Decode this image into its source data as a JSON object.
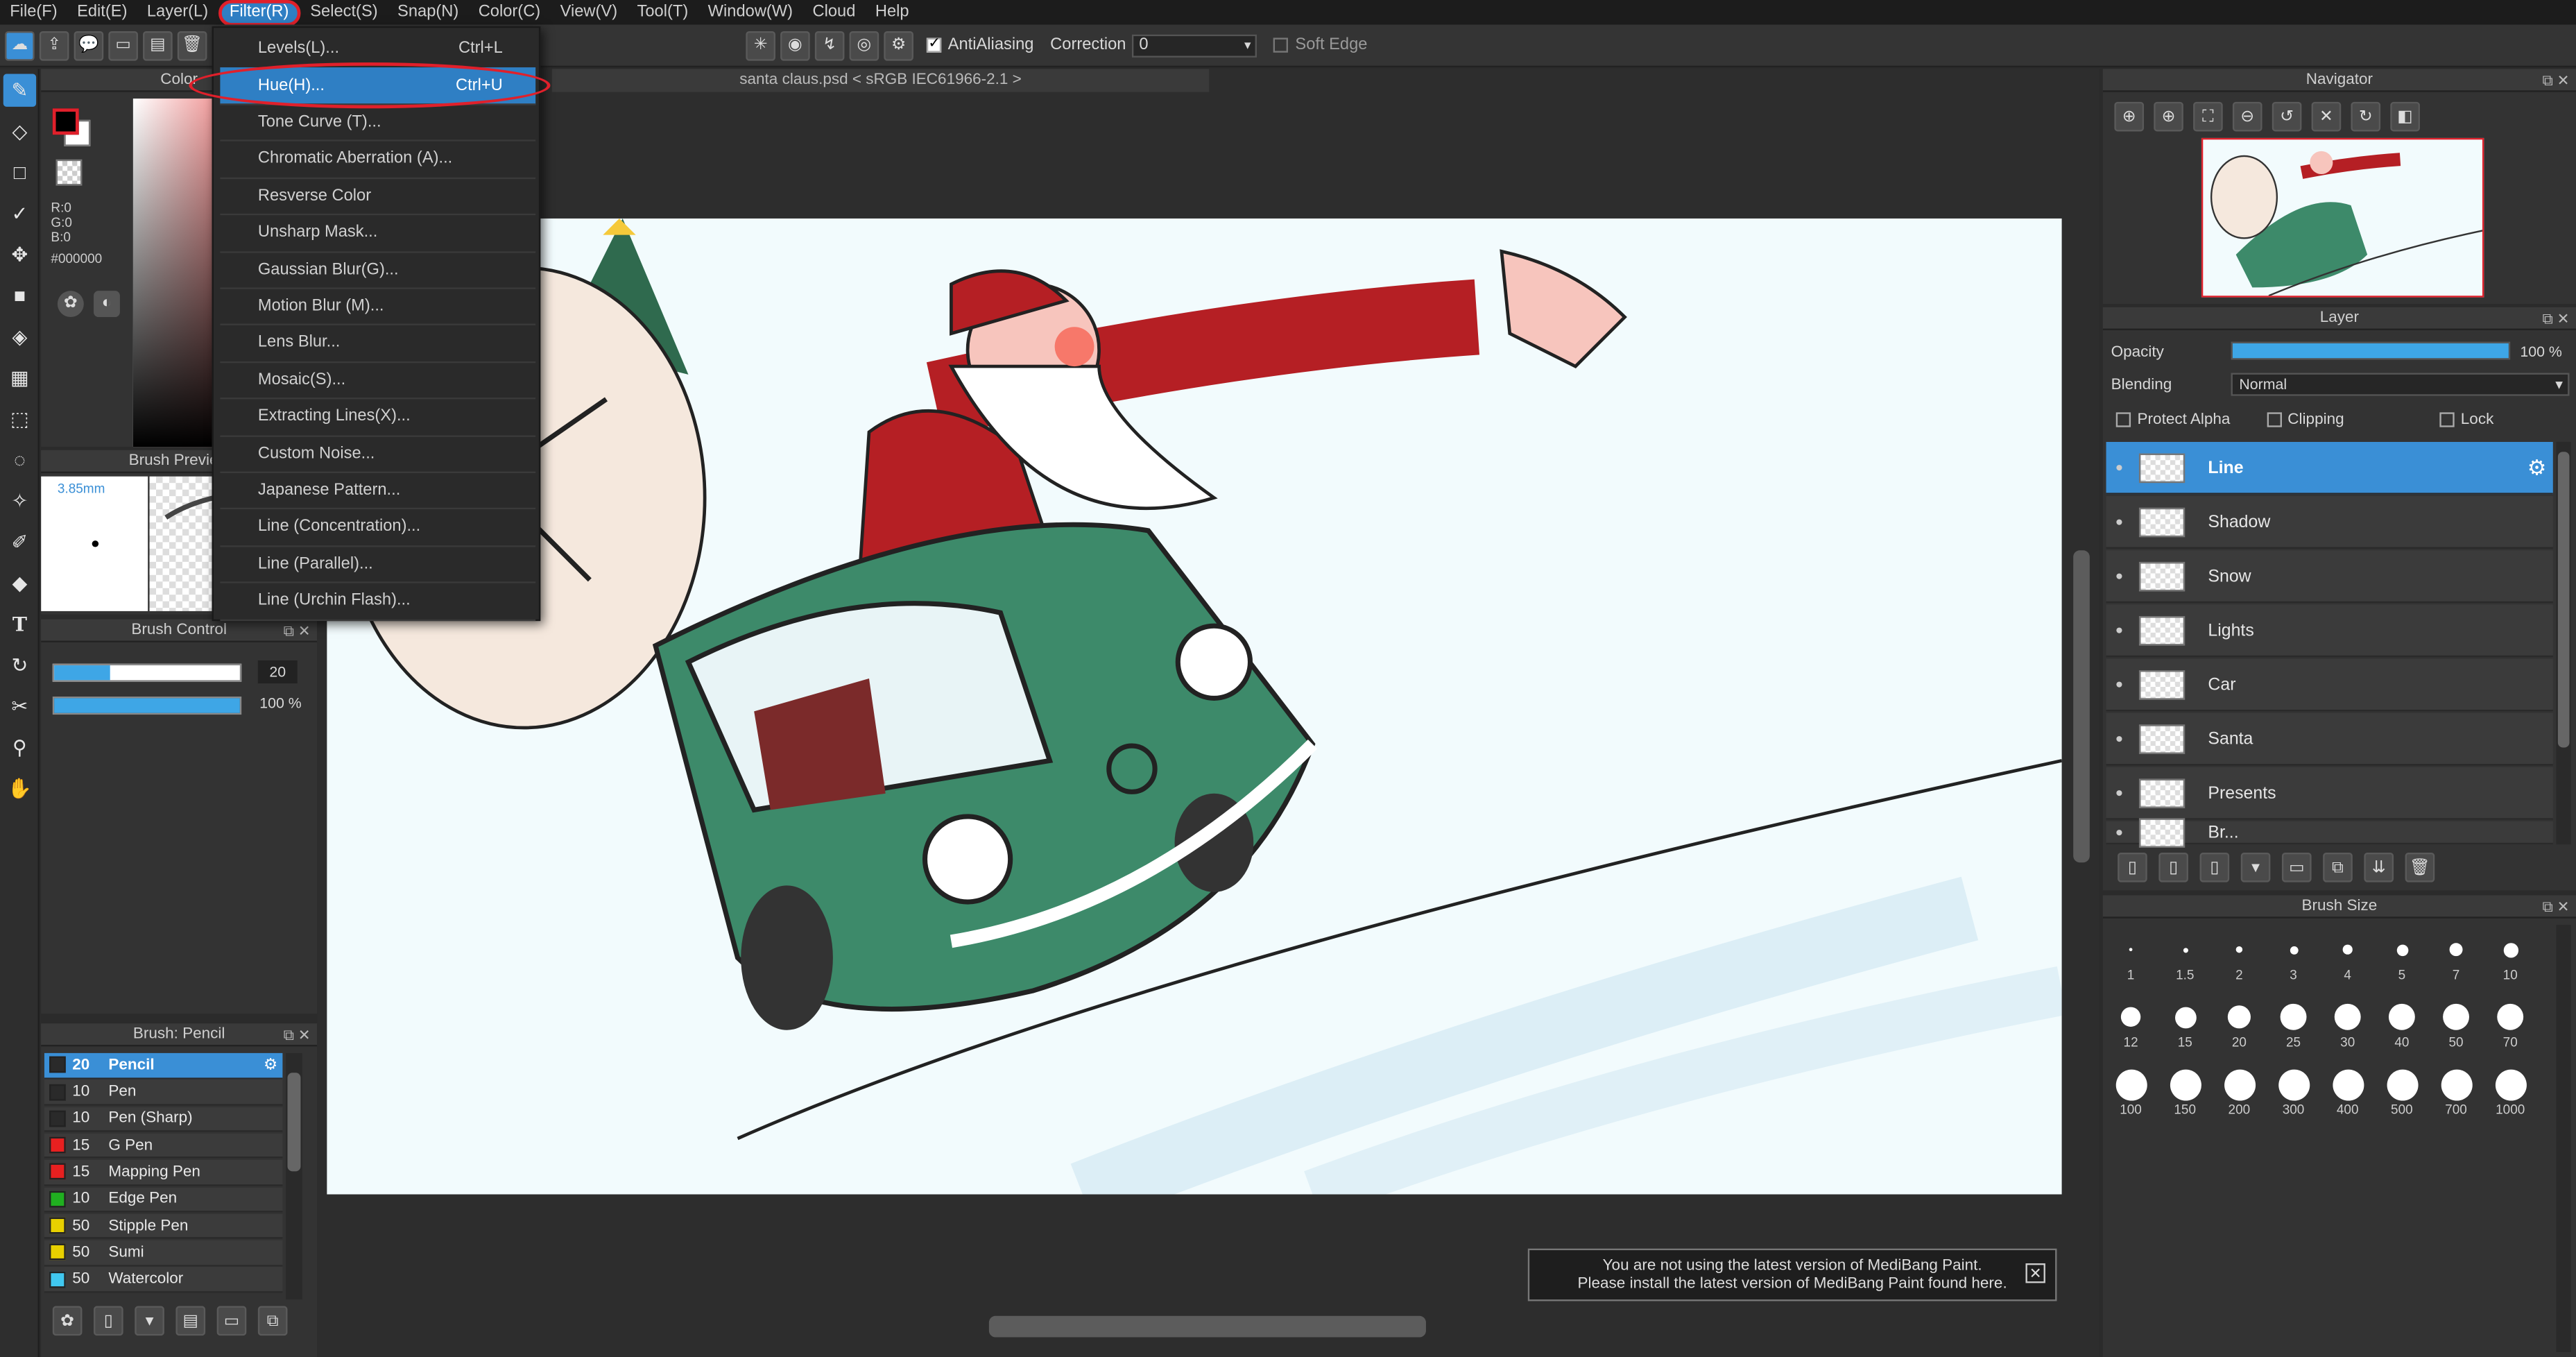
{
  "menu": [
    "File(F)",
    "Edit(E)",
    "Layer(L)",
    "Filter(R)",
    "Select(S)",
    "Snap(N)",
    "Color(C)",
    "View(V)",
    "Tool(T)",
    "Window(W)",
    "Cloud",
    "Help"
  ],
  "toolbar": {
    "antialiasing_label": "AntiAliasing",
    "correction_label": "Correction",
    "correction_value": "0",
    "soft_edge_label": "Soft Edge"
  },
  "filter_menu": [
    {
      "label": "Levels(L)...",
      "shortcut": "Ctrl+L"
    },
    {
      "label": "Hue(H)...",
      "shortcut": "Ctrl+U"
    },
    {
      "label": "Tone Curve (T)...",
      "shortcut": ""
    },
    {
      "label": "Chromatic Aberration (A)...",
      "shortcut": ""
    },
    {
      "label": "Resverse Color",
      "shortcut": ""
    },
    {
      "label": "Unsharp Mask...",
      "shortcut": ""
    },
    {
      "label": "Gaussian Blur(G)...",
      "shortcut": ""
    },
    {
      "label": "Motion Blur (M)...",
      "shortcut": ""
    },
    {
      "label": "Lens Blur...",
      "shortcut": ""
    },
    {
      "label": "Mosaic(S)...",
      "shortcut": ""
    },
    {
      "label": "Extracting Lines(X)...",
      "shortcut": ""
    },
    {
      "label": "Custom Noise...",
      "shortcut": ""
    },
    {
      "label": "Japanese Pattern...",
      "shortcut": ""
    },
    {
      "label": "Line (Concentration)...",
      "shortcut": ""
    },
    {
      "label": "Line (Parallel)...",
      "shortcut": ""
    },
    {
      "label": "Line (Urchin Flash)...",
      "shortcut": ""
    }
  ],
  "document_tab": "santa claus.psd < sRGB IEC61966-2.1 >",
  "color_panel": {
    "title": "Color",
    "r": "R:0",
    "g": "G:0",
    "b": "B:0",
    "hex": "#000000",
    "fg": "#000000",
    "bg": "#ffffff"
  },
  "brush_preview": {
    "title": "Brush Preview",
    "size": "3.85mm"
  },
  "brush_control": {
    "title": "Brush Control",
    "size_value": "20",
    "size_fill": 0.3,
    "opacity_value": "100 %",
    "opacity_fill": 1.0
  },
  "brush_list": {
    "title": "Brush: Pencil",
    "items": [
      {
        "size": "20",
        "name": "Pencil",
        "color": "#2a2a2a",
        "selected": true
      },
      {
        "size": "10",
        "name": "Pen",
        "color": "#2a2a2a"
      },
      {
        "size": "10",
        "name": "Pen (Sharp)",
        "color": "#2a2a2a"
      },
      {
        "size": "15",
        "name": "G Pen",
        "color": "#e82020"
      },
      {
        "size": "15",
        "name": "Mapping Pen",
        "color": "#e82020"
      },
      {
        "size": "10",
        "name": "Edge Pen",
        "color": "#20b020"
      },
      {
        "size": "50",
        "name": "Stipple Pen",
        "color": "#e8d000"
      },
      {
        "size": "50",
        "name": "Sumi",
        "color": "#e8d000"
      },
      {
        "size": "50",
        "name": "Watercolor",
        "color": "#40c8f0"
      }
    ]
  },
  "navigator": {
    "title": "Navigator"
  },
  "layer_panel": {
    "title": "Layer",
    "opacity_label": "Opacity",
    "opacity_value": "100 %",
    "blending_label": "Blending",
    "blending_value": "Normal",
    "protect_alpha": "Protect Alpha",
    "clipping": "Clipping",
    "lock": "Lock",
    "layers": [
      "Line",
      "Shadow",
      "Snow",
      "Lights",
      "Car",
      "Santa",
      "Presents",
      "Br..."
    ]
  },
  "brush_size": {
    "title": "Brush Size",
    "sizes": [
      "1",
      "1.5",
      "2",
      "3",
      "4",
      "5",
      "7",
      "10",
      "12",
      "15",
      "20",
      "25",
      "30",
      "40",
      "50",
      "70",
      "100",
      "150",
      "200",
      "300",
      "400",
      "500",
      "700",
      "1000"
    ]
  },
  "notice": {
    "line1": "You are not using the latest version of MediBang Paint.",
    "line2": "Please install the latest version of MediBang Paint found here."
  }
}
